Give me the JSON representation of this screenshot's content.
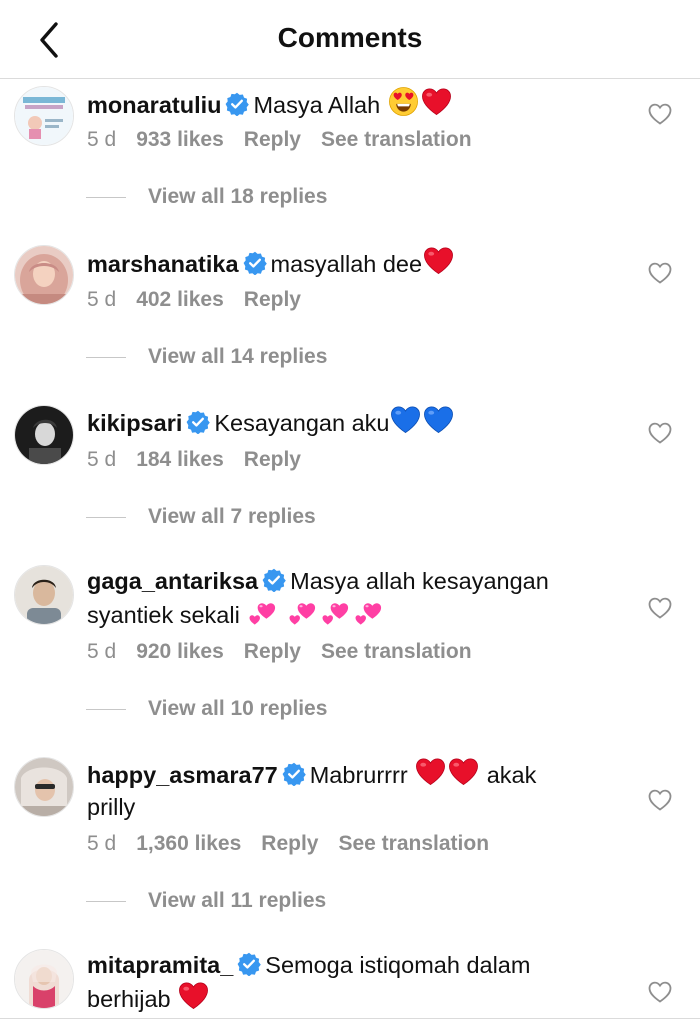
{
  "header": {
    "title": "Comments"
  },
  "comments": [
    {
      "username": "monaratuliu",
      "text": "Masya Allah",
      "emojis": [
        "heart-eyes",
        "red-heart"
      ],
      "time": "5 d",
      "likes": "933 likes",
      "reply": "Reply",
      "translate": "See translation",
      "view_replies": "View all 18 replies"
    },
    {
      "username": "marshanatika",
      "text": "masyallah dee",
      "emojis": [
        "red-heart"
      ],
      "time": "5 d",
      "likes": "402 likes",
      "reply": "Reply",
      "view_replies": "View all 14 replies"
    },
    {
      "username": "kikipsari",
      "text": "Kesayangan aku",
      "emojis": [
        "blue-heart",
        "blue-heart"
      ],
      "time": "5 d",
      "likes": "184 likes",
      "reply": "Reply",
      "view_replies": "View all 7 replies"
    },
    {
      "username": "gaga_antariksa",
      "text": "Masya allah kesayangan",
      "text2": "syantiek sekali",
      "emojis": [
        "two-hearts",
        "two-hearts",
        "two-hearts",
        "two-hearts"
      ],
      "time": "5 d",
      "likes": "920 likes",
      "reply": "Reply",
      "translate": "See translation",
      "view_replies": "View all 10 replies"
    },
    {
      "username": "happy_asmara77",
      "text": "Mabrurrrr",
      "text_after": "akak",
      "text2": "prilly",
      "emojis": [
        "red-heart",
        "red-heart"
      ],
      "time": "5 d",
      "likes": "1,360 likes",
      "reply": "Reply",
      "translate": "See translation",
      "view_replies": "View all 11 replies"
    },
    {
      "username": "mitapramita_",
      "text": "Semoga istiqomah dalam",
      "text2": "berhijab",
      "emojis": [
        "red-heart"
      ]
    }
  ],
  "colors": {
    "verified": "#3897f0",
    "muted": "#8e8e8e",
    "heart_red": "#e8102a",
    "heart_blue": "#1a6fe8",
    "heart_pink": "#ff3fa4"
  }
}
